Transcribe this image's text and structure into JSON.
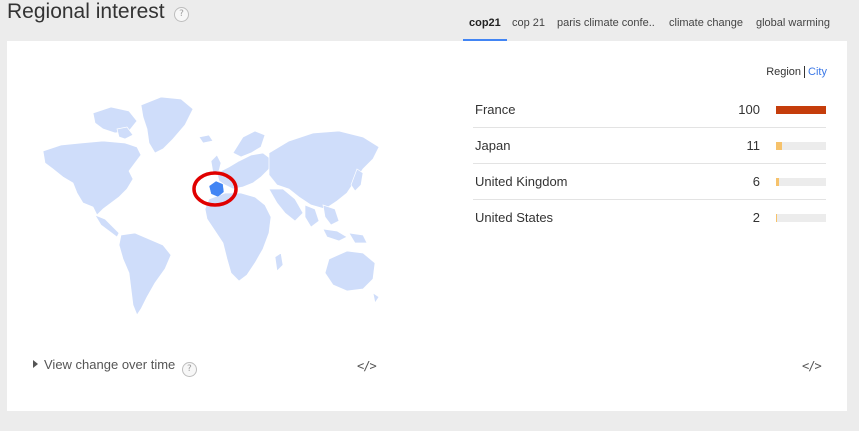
{
  "header": {
    "title": "Regional interest",
    "help_icon": "?"
  },
  "tabs": [
    {
      "label": "cop21",
      "active": true
    },
    {
      "label": "cop 21",
      "active": false
    },
    {
      "label": "paris climate confe..",
      "active": false
    },
    {
      "label": "climate change",
      "active": false
    },
    {
      "label": "global warming",
      "active": false
    }
  ],
  "granularity": {
    "region_label": "Region",
    "city_label": "City",
    "selected": "Region"
  },
  "map": {
    "highlighted_country": "France",
    "highlight_color": "#4285f4",
    "land_color": "#cfddfa",
    "annotation_circle_color": "#e00000"
  },
  "regions": [
    {
      "name": "France",
      "value": "100",
      "fraction": 1.0,
      "bar_color": "#c53d0b"
    },
    {
      "name": "Japan",
      "value": "11",
      "fraction": 0.11,
      "bar_color": "#f6c26b"
    },
    {
      "name": "United Kingdom",
      "value": "6",
      "fraction": 0.06,
      "bar_color": "#f6c26b"
    },
    {
      "name": "United States",
      "value": "2",
      "fraction": 0.02,
      "bar_color": "#f6c26b"
    }
  ],
  "footer": {
    "view_change_label": "View change over time",
    "view_change_help": "?",
    "embed_icon": "</>"
  }
}
